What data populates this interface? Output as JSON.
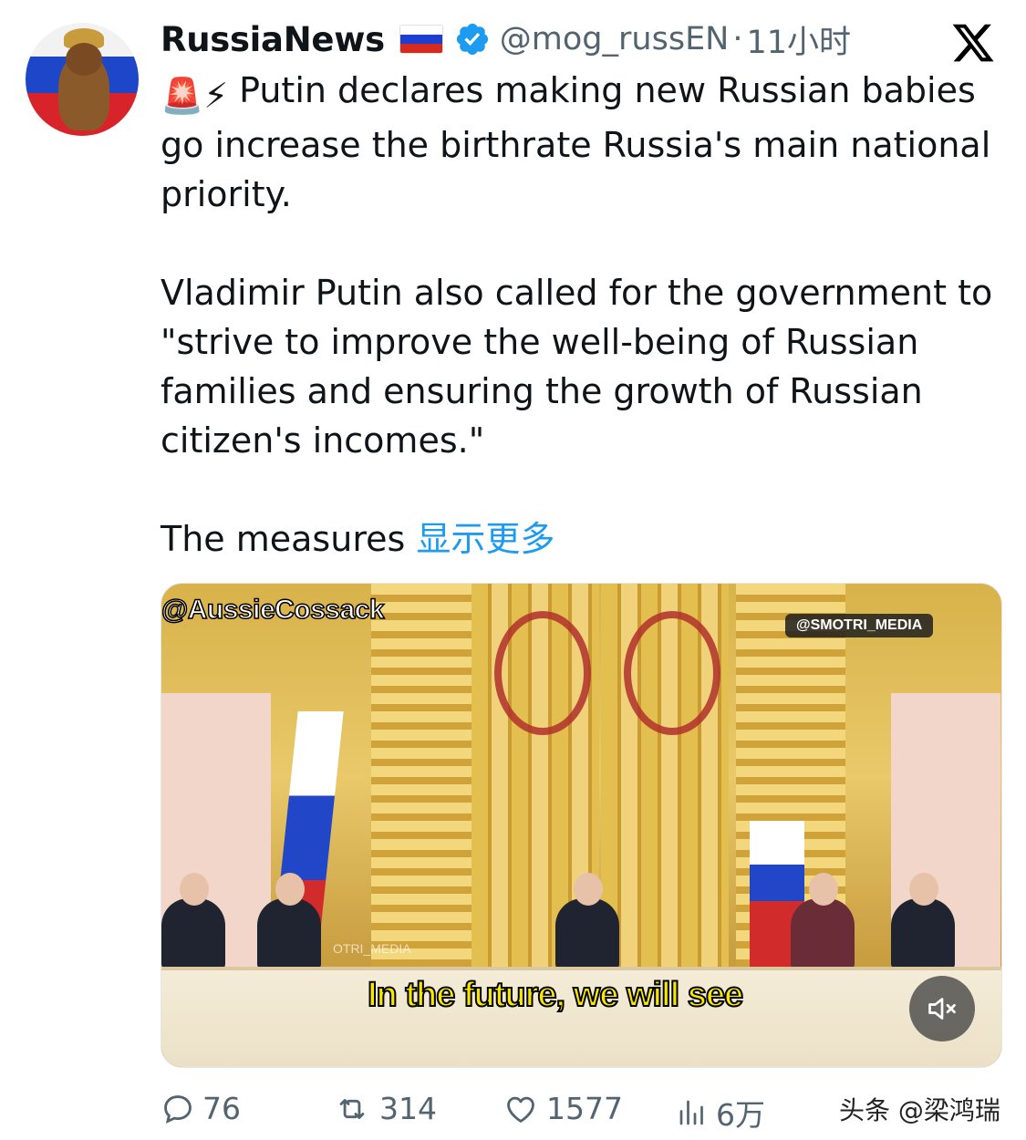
{
  "account": {
    "name": "RussiaNews",
    "handle": "@mog_russEN",
    "separator": "·",
    "time": "11小时"
  },
  "tweet": {
    "lead_emoji": "🚨⚡",
    "line1": "Putin declares making new Russian babies go increase the birthrate Russia's main national priority.",
    "line2": "Vladimir Putin also called for the government to \"strive to improve the well-being of Russian families and ensuring the growth of Russian citizen's incomes.\"",
    "line3": "The measures",
    "show_more": "显示更多"
  },
  "media": {
    "watermark_left": "@AussieCossack",
    "watermark_right": "@SMOTRI_MEDIA",
    "watermark_mid": "OTRI_MEDIA",
    "subtitle": "In the future, we will see",
    "mute_icon": "speaker-muted-icon"
  },
  "actions": {
    "replies": "76",
    "reposts": "314",
    "likes": "1577",
    "views": "6万"
  },
  "footer_watermark": "头条 @梁鸿瑞",
  "colors": {
    "accent": "#1d9bf0",
    "text": "#0f1419",
    "muted": "#536471",
    "subtitle": "#f7e600"
  }
}
